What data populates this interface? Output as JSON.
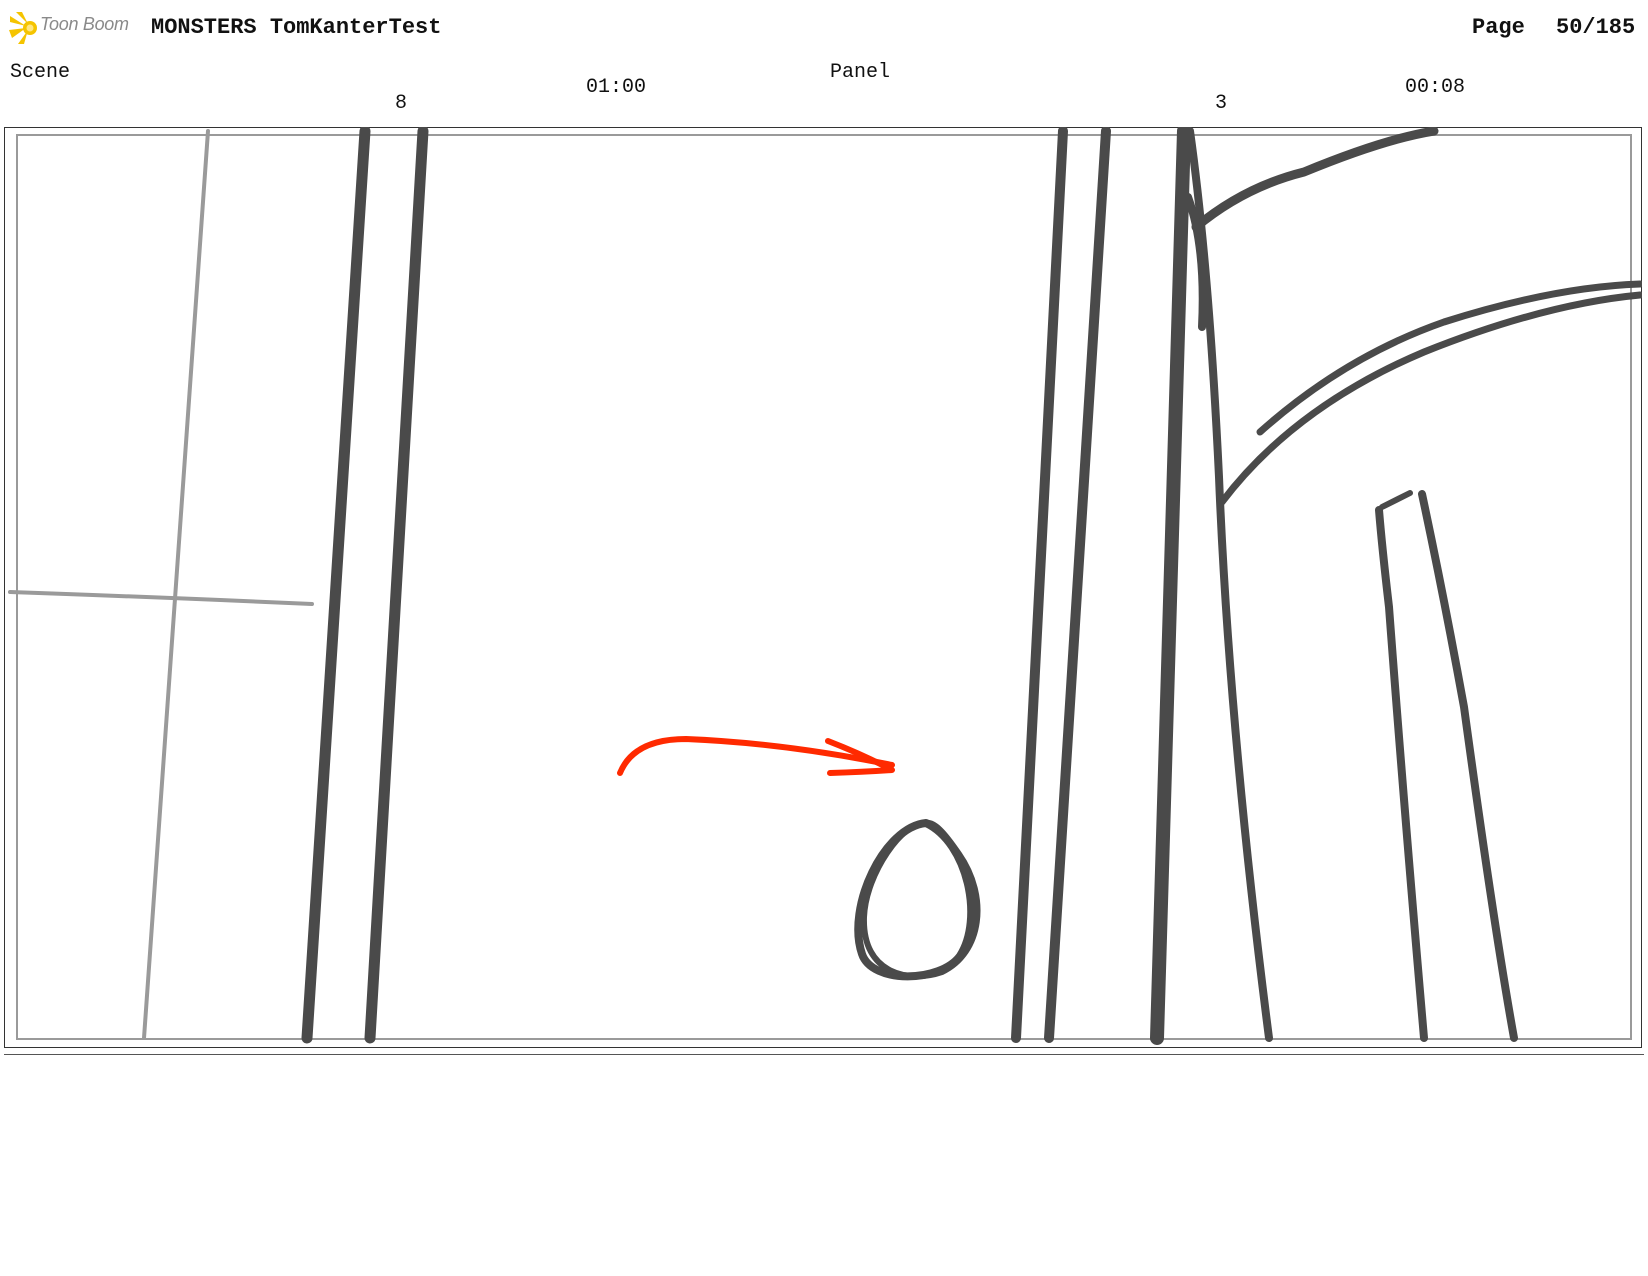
{
  "header": {
    "logo_text": "Toon Boom",
    "project_title": "MONSTERS TomKanterTest",
    "page_label": "Page",
    "page_number": "50/185"
  },
  "scene": {
    "label": "Scene",
    "number": "8",
    "duration": "01:00"
  },
  "panel": {
    "label": "Panel",
    "number": "3",
    "duration": "00:08"
  },
  "colors": {
    "logo_accent": "#F5C400",
    "sketch_line": "#4a4a4a",
    "guide_line": "#9a9a9a",
    "arrow": "#FF2A00"
  },
  "icons": {
    "logo": "toon-boom-star-logo"
  }
}
